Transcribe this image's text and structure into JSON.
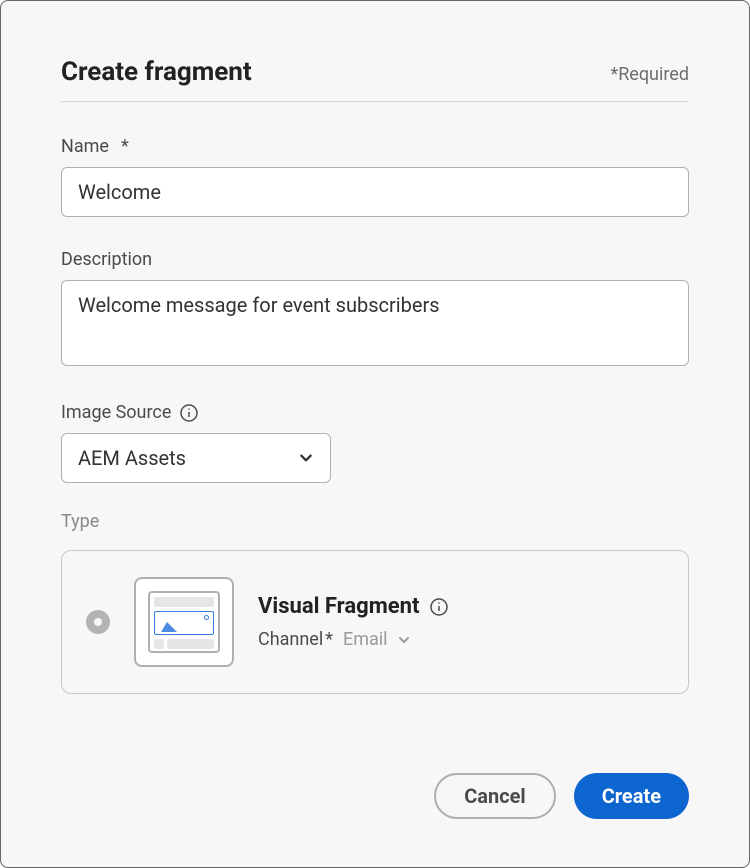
{
  "header": {
    "title": "Create fragment",
    "required_note": "*Required"
  },
  "name": {
    "label": "Name",
    "required_mark": "*",
    "value": "Welcome"
  },
  "description": {
    "label": "Description",
    "value": "Welcome message for event subscribers"
  },
  "image_source": {
    "label": "Image Source",
    "selected": "AEM Assets"
  },
  "type": {
    "section_label": "Type",
    "option_title": "Visual Fragment",
    "channel_label": "Channel",
    "channel_required_mark": "*",
    "channel_value": "Email"
  },
  "footer": {
    "cancel": "Cancel",
    "create": "Create"
  }
}
